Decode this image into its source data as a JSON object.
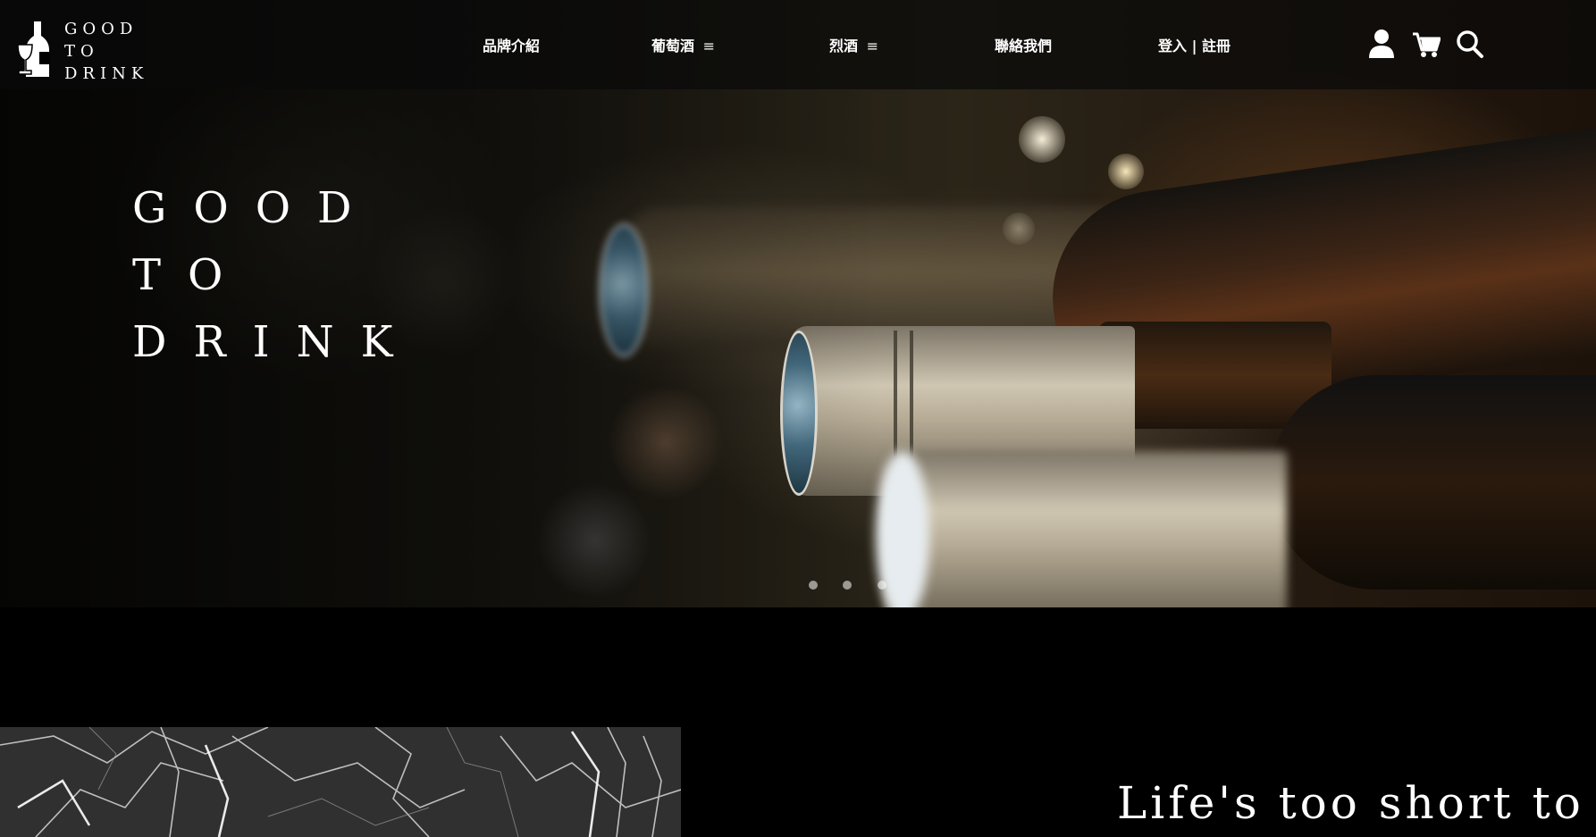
{
  "brand": {
    "logo_lines": [
      "GOOD",
      "TO",
      "DRINK"
    ]
  },
  "nav": {
    "items": [
      {
        "label": "品牌介紹",
        "has_menu": false
      },
      {
        "label": "葡萄酒",
        "has_menu": true
      },
      {
        "label": "烈酒",
        "has_menu": true
      },
      {
        "label": "聯絡我們",
        "has_menu": false
      },
      {
        "label": "登入 | 註冊",
        "has_menu": false
      }
    ],
    "menu_icon_glyph": "≡"
  },
  "header_icons": [
    "user-icon",
    "cart-icon",
    "search-icon"
  ],
  "hero": {
    "title_lines": [
      "GOOD",
      "TO",
      "DRINK"
    ],
    "carousel_count": 3,
    "carousel_active": 1
  },
  "section": {
    "tagline": "Life's too short to"
  },
  "colors": {
    "background": "#000000",
    "header_bg": "rgba(10,10,10,0.72)",
    "text": "#ffffff"
  }
}
